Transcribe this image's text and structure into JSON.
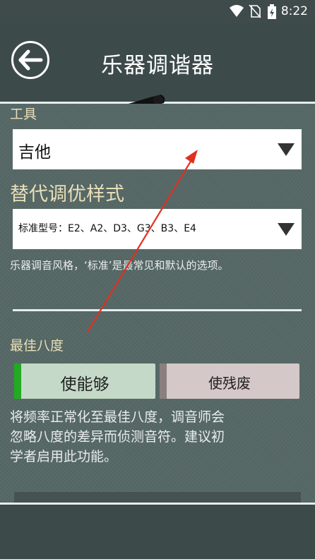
{
  "status_bar": {
    "time": "8:22",
    "icons": [
      "wifi-icon",
      "no-sim-icon",
      "battery-charging-icon"
    ]
  },
  "header": {
    "title": "乐器调谐器",
    "back_icon": "arrow-left-icon"
  },
  "instrument": {
    "label": "工具",
    "value": "吉他"
  },
  "alt_tuning": {
    "label": "替代调优样式",
    "value": "标准型号：E2、A2、D3、G3、B3、E4",
    "help": "乐器调音风格，‘标准’是最常见和默认的选项。"
  },
  "best_octave": {
    "label": "最佳八度",
    "enable_label": "使能够",
    "disable_label": "使残废",
    "enabled": true,
    "help_lines": [
      "将频率正常化至最佳八度，调音师会",
      "忽略八度的差异而侦测音符。建议初",
      "学者启用此功能。"
    ]
  },
  "colors": {
    "background": "#3d4a4a",
    "panel": "#566866",
    "label_text": "#e8dfb8",
    "enable_accent": "#22aa22",
    "disable_accent": "#8a8080",
    "annotation_arrow": "#e03020"
  }
}
